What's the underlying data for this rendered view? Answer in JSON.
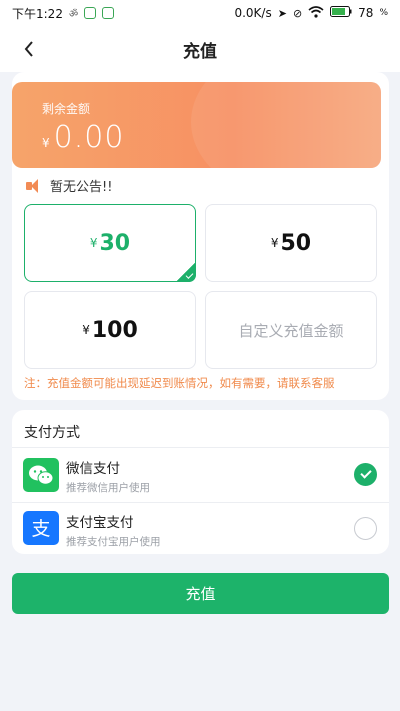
{
  "status_bar": {
    "time": "下午1:22",
    "network_speed": "0.0K/s",
    "battery": "78"
  },
  "nav": {
    "title": "充值",
    "back_icon": "chevron-left-icon"
  },
  "balance": {
    "label": "剩余金额",
    "currency": "¥",
    "amount": "0.00"
  },
  "notice": {
    "icon": "speaker-icon",
    "text": "暂无公告!!"
  },
  "amounts": {
    "options": [
      {
        "currency": "¥",
        "value": "30",
        "selected": true
      },
      {
        "currency": "¥",
        "value": "50",
        "selected": false
      },
      {
        "currency": "¥",
        "value": "100",
        "selected": false
      }
    ],
    "custom_label": "自定义充值金额",
    "note": "注：充值金额可能出现延迟到账情况，如有需要，请联系客服"
  },
  "payment": {
    "title": "支付方式",
    "methods": [
      {
        "name": "微信支付",
        "desc": "推荐微信用户使用",
        "icon": "wechat-icon",
        "checked": true
      },
      {
        "name": "支付宝支付",
        "desc": "推荐支付宝用户使用",
        "icon": "alipay-icon",
        "checked": false
      }
    ]
  },
  "submit": {
    "label": "充值"
  },
  "colors": {
    "accent": "#1db36a",
    "balance_gradient_start": "#f6a46a",
    "balance_gradient_end": "#f79063",
    "note": "#f08a4b",
    "wechat": "#21c15f",
    "alipay": "#1677ff"
  }
}
